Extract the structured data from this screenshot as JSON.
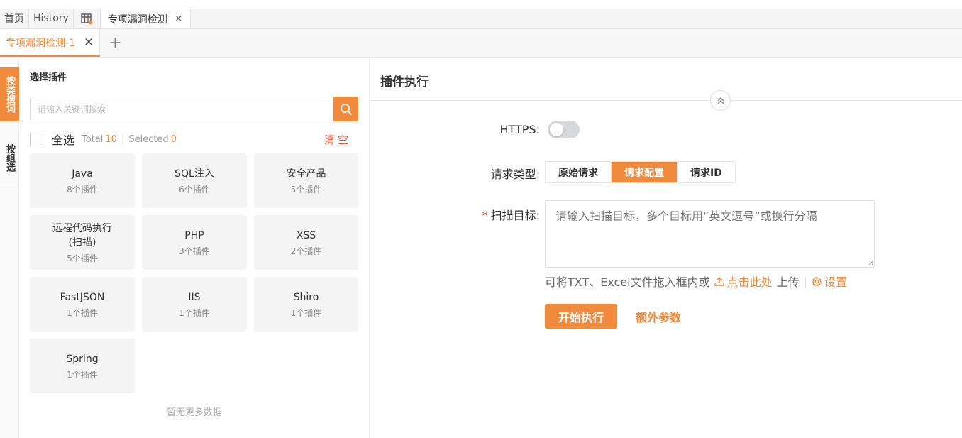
{
  "tabs_top": [
    {
      "label": "首页"
    },
    {
      "label": "History"
    },
    {
      "label": "专项漏洞检测"
    }
  ],
  "tabs_sub": {
    "active_label": "专项漏洞检测-1"
  },
  "side_tabs": {
    "active": "按类搜词",
    "inactive": "按组选"
  },
  "plugin_panel": {
    "title": "选择插件",
    "search_placeholder": "请输入关键词搜索",
    "select_all": "全选",
    "total_label": "Total",
    "total_value": "10",
    "selected_label": "Selected",
    "selected_value": "0",
    "clear_label": "清空",
    "cards": [
      {
        "name": "Java",
        "count": "8个插件"
      },
      {
        "name": "SQL注入",
        "count": "6个插件"
      },
      {
        "name": "安全产品",
        "count": "5个插件"
      },
      {
        "name": "远程代码执行\n(扫描)",
        "count": "5个插件"
      },
      {
        "name": "PHP",
        "count": "3个插件"
      },
      {
        "name": "XSS",
        "count": "2个插件"
      },
      {
        "name": "FastJSON",
        "count": "1个插件"
      },
      {
        "name": "IIS",
        "count": "1个插件"
      },
      {
        "name": "Shiro",
        "count": "1个插件"
      },
      {
        "name": "Spring",
        "count": "1个插件"
      }
    ],
    "no_more": "暂无更多数据"
  },
  "exec_panel": {
    "title": "插件执行",
    "https_label": "HTTPS:",
    "https_enabled": false,
    "request_type_label": "请求类型:",
    "request_types": [
      "原始请求",
      "请求配置",
      "请求ID"
    ],
    "request_type_selected": "请求配置",
    "target_label": "扫描目标:",
    "target_required_mark": "*",
    "target_placeholder": "请输入扫描目标，多个目标用“英文逗号”或换行分隔",
    "upload_hint": "可将TXT、Excel文件拖入框内或",
    "upload_link": "点击此处",
    "upload_suffix": "上传",
    "settings_label": "设置",
    "run_button": "开始执行",
    "extra_params": "额外参数"
  },
  "colors": {
    "accent": "#f08a3c",
    "danger": "#e8502f"
  }
}
